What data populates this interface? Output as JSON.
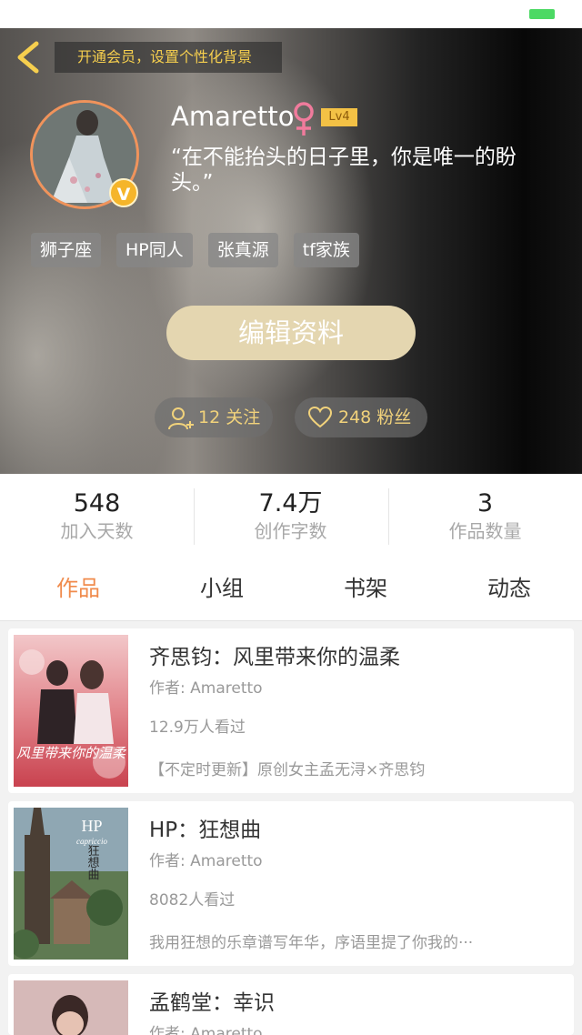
{
  "header": {
    "member_banner": "开通会员，设置个性化背景"
  },
  "profile": {
    "username": "Amaretto",
    "gender_symbol": "♀",
    "level": "Lv4",
    "vip_badge": "V",
    "signature": "“在不能抬头的日子里，你是唯一的盼头。”",
    "tags": [
      "狮子座",
      "HP同人",
      "张真源",
      "tf家族"
    ],
    "edit_button": "编辑资料",
    "following": "12 关注",
    "followers": "248 粉丝"
  },
  "stats": [
    {
      "value": "548",
      "label": "加入天数"
    },
    {
      "value": "7.4万",
      "label": "创作字数"
    },
    {
      "value": "3",
      "label": "作品数量"
    }
  ],
  "tabs": [
    "作品",
    "小组",
    "书架",
    "动态"
  ],
  "active_tab": "作品",
  "works": [
    {
      "title": "齐思钧：风里带来你的温柔",
      "author": "作者: Amaretto",
      "views": "12.9万人看过",
      "description": "【不定时更新】原创女主孟无浔×齐思钧",
      "cover_text": "风里带来你的温柔"
    },
    {
      "title": "HP：狂想曲",
      "author": "作者: Amaretto",
      "views": "8082人看过",
      "description": "我用狂想的乐章谱写年华，序语里提了你我的···",
      "cover_text": "HP",
      "cover_subtext": "capriccio",
      "cover_vertical": "狂想曲"
    },
    {
      "title": "孟鹤堂：幸识",
      "author": "作者: Amaretto"
    }
  ],
  "colors": {
    "accent_orange": "#f08b4c",
    "gold_text": "#f6cf4e",
    "edit_button_bg": "#e4d6b0",
    "level_badge_bg": "#f3c145",
    "battery_green": "#4cd964"
  }
}
